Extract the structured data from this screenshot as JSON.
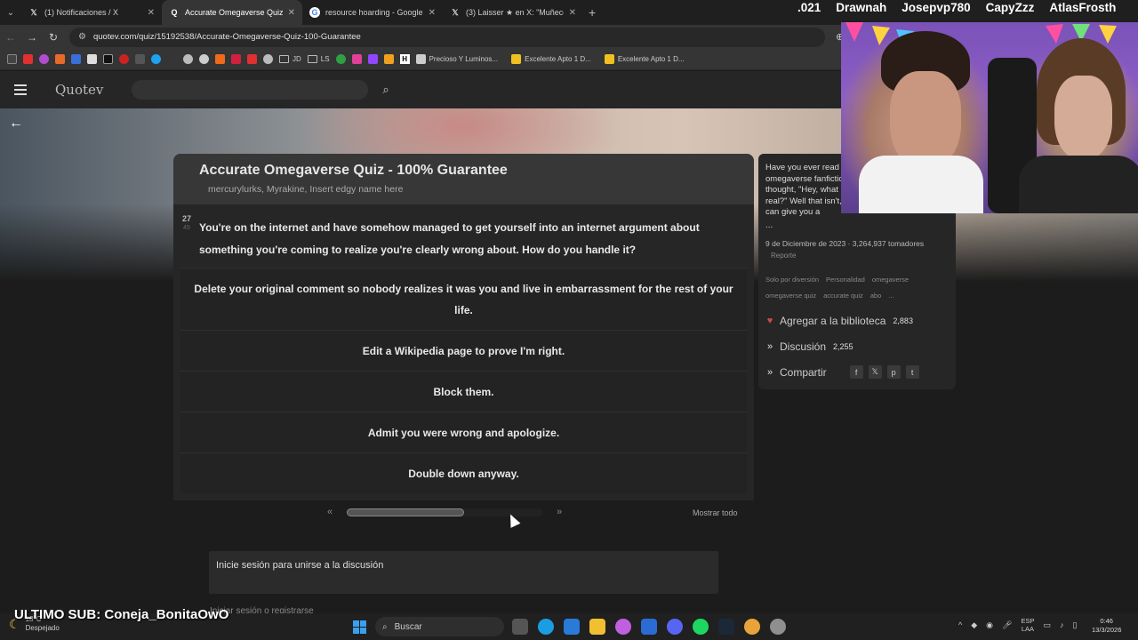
{
  "browser": {
    "tabs": [
      {
        "label": "(1) Notificaciones / X",
        "icon": "x-logo-icon"
      },
      {
        "label": "Accurate Omegaverse Quiz - 100",
        "icon": "quotev-icon",
        "active": true
      },
      {
        "label": "resource hoarding - Google Se",
        "icon": "google-icon"
      },
      {
        "label": "(3) Laisser ★ en X: \"Muñecos de",
        "icon": "x-logo-icon"
      }
    ],
    "url": "quotev.com/quiz/15192538/Accurate-Omegaverse-Quiz-100-Guarantee",
    "bookmarks": [
      {
        "type": "folder",
        "label": "JD"
      },
      {
        "type": "folder",
        "label": "LS"
      },
      {
        "type": "link",
        "label": "H"
      },
      {
        "type": "link",
        "label": "Precioso Y Luminos..."
      },
      {
        "type": "link",
        "label": "Excelente Apto 1 D..."
      },
      {
        "type": "link",
        "label": "Excelente Apto 1 D..."
      }
    ]
  },
  "site": {
    "logo": "Quotev"
  },
  "quiz": {
    "title": "Accurate Omegaverse Quiz - 100% Guarantee",
    "authors": "mercurylurks, Myrakine, Insert edgy name here",
    "question_number": "27",
    "question_total": "45",
    "question": "You're on the internet and have somehow managed to get yourself into an internet argument about something you're coming to realize you're clearly wrong about. How do you handle it?",
    "answers": [
      "Delete your original comment so nobody realizes it was you and live in embarrassment for the rest of your life.",
      "Edit a Wikipedia page to prove I'm right.",
      "Block them.",
      "Admit you were wrong and apologize.",
      "Double down anyway."
    ],
    "prev_label": "«",
    "next_label": "»",
    "progress_fraction": 0.6,
    "show_all": "Mostrar todo",
    "comment_prompt": "Inicie sesión para unirse a la discusión",
    "comment_link": "Iniciar sesión o registrarse"
  },
  "sidebar": {
    "description": "Have you ever read omegaverse fanfiction and thought, \"Hey, what if it was real?\" Well that isn't, but we can give you a",
    "more": "...",
    "meta": "9 de Diciembre de 2023 · 3,264,937 tomadores",
    "report": "Reporte",
    "tags": [
      "Solo por diversión",
      "Personalidad",
      "omegaverse",
      "omegaverse quiz",
      "accurate quiz",
      "abo",
      "..."
    ],
    "actions": {
      "library_label": "Agregar a la biblioteca",
      "library_count": "2,883",
      "discussion_label": "Discusión",
      "discussion_count": "2,255",
      "share_label": "Compartir"
    }
  },
  "overlay": {
    "names": [
      ".021",
      "Drawnah",
      "Josepvp780",
      "CapyZzz",
      "AtlasFrosth"
    ],
    "last_sub": "ULTIMO SUB: Coneja_BonitaOwO"
  },
  "taskbar": {
    "weather_temp": "18°C",
    "weather_desc": "Despejado",
    "search_placeholder": "Buscar",
    "lang_top": "ESP",
    "lang_bottom": "LAA",
    "time": "0:46",
    "date": "13/3/2026"
  },
  "colors": {
    "page_bg": "#1c1c1c",
    "card_bg": "#262626",
    "heart": "#c84b4b",
    "webcam_bg": "#7a52b8"
  }
}
